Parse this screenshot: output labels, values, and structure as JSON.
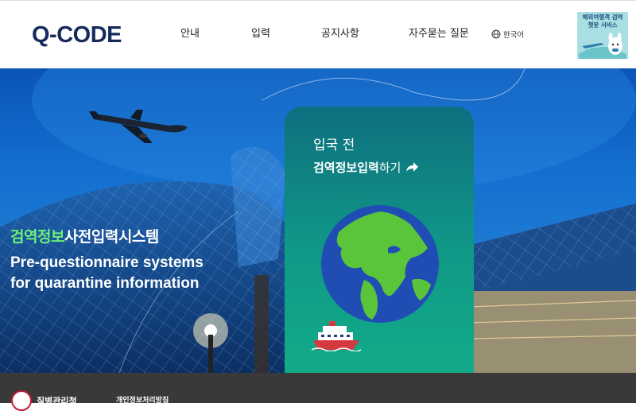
{
  "header": {
    "logo": "Q-CODE",
    "nav": [
      {
        "label": "안내"
      },
      {
        "label": "입력"
      },
      {
        "label": "공지사항"
      },
      {
        "label": "자주묻는 질문"
      }
    ],
    "language": "한국어",
    "chatbot_banner": {
      "line1": "해외여행객 검역",
      "line2": "챗봇 서비스"
    }
  },
  "hero": {
    "title_accent": "검역정보",
    "title_rest": "사전입력시스템",
    "subtitle_line1": "Pre-questionnaire systems",
    "subtitle_line2": "for quarantine information",
    "card": {
      "line1": "입국 전",
      "line2_bold": "검역정보입력",
      "line2_rest": "하기"
    }
  },
  "footer": {
    "org": "질병관리청",
    "privacy_link": "개인정보처리방침"
  },
  "colors": {
    "logo": "#162a5c",
    "hero_blue": "#1470d0",
    "accent_green": "#6cf07a",
    "card_teal": "#109987",
    "footer": "#393939"
  },
  "icons": [
    "globe-icon",
    "arrow-icon",
    "earth-globe-icon",
    "ship-icon",
    "airplane-icon",
    "chatbot-mascot-icon"
  ]
}
